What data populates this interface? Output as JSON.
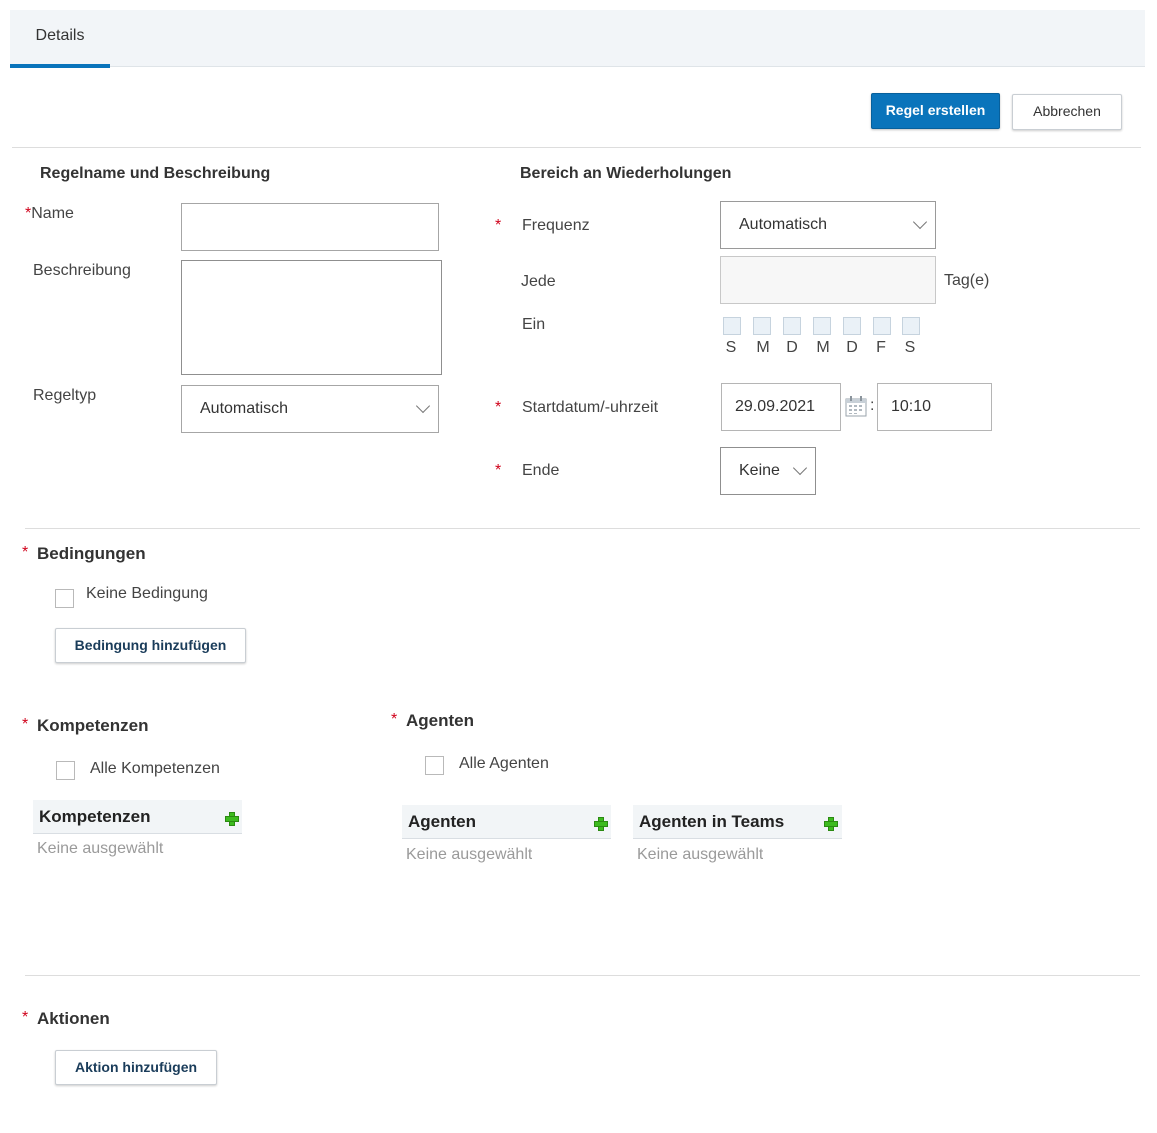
{
  "tabs": [
    {
      "label": "Details"
    }
  ],
  "toolbar": {
    "create_label": "Regel erstellen",
    "cancel_label": "Abbrechen"
  },
  "rule": {
    "section_title": "Regelname und Beschreibung",
    "required_mark": "*",
    "name_label": "Name",
    "name_value": "",
    "description_label": "Beschreibung",
    "description_value": "",
    "type_label": "Regeltyp",
    "type_value": "Automatisch"
  },
  "recurrence": {
    "section_title": "Bereich an Wiederholungen",
    "required_mark": "*",
    "frequency_label": "Frequenz",
    "frequency_value": "Automatisch",
    "every_label": "Jede",
    "every_value": "",
    "every_unit": "Tag(e)",
    "on_label": "Ein",
    "days": [
      "S",
      "M",
      "D",
      "M",
      "D",
      "F",
      "S"
    ],
    "start_label": "Startdatum/-uhrzeit",
    "start_date": "29.09.2021",
    "time_separator": ":",
    "start_time": "10:10",
    "end_label": "Ende",
    "end_value": "Keine"
  },
  "conditions": {
    "required_mark": "*",
    "title": "Bedingungen",
    "no_condition_label": "Keine Bedingung",
    "add_button": "Bedingung hinzufügen"
  },
  "skills": {
    "required_mark": "*",
    "title": "Kompetenzen",
    "all_label": "Alle Kompetenzen",
    "grid_header": "Kompetenzen",
    "empty_text": "Keine ausgewählt"
  },
  "agents": {
    "required_mark": "*",
    "title": "Agenten",
    "all_label": "Alle Agenten",
    "grid_header": "Agenten",
    "empty_text": "Keine ausgewählt",
    "teams_header": "Agenten in Teams",
    "teams_empty_text": "Keine ausgewählt"
  },
  "actions": {
    "required_mark": "*",
    "title": "Aktionen",
    "add_button": "Aktion hinzufügen"
  },
  "colors": {
    "accent": "#0a74bb",
    "required": "#d0021b",
    "add_icon": "#3dbb1e"
  }
}
